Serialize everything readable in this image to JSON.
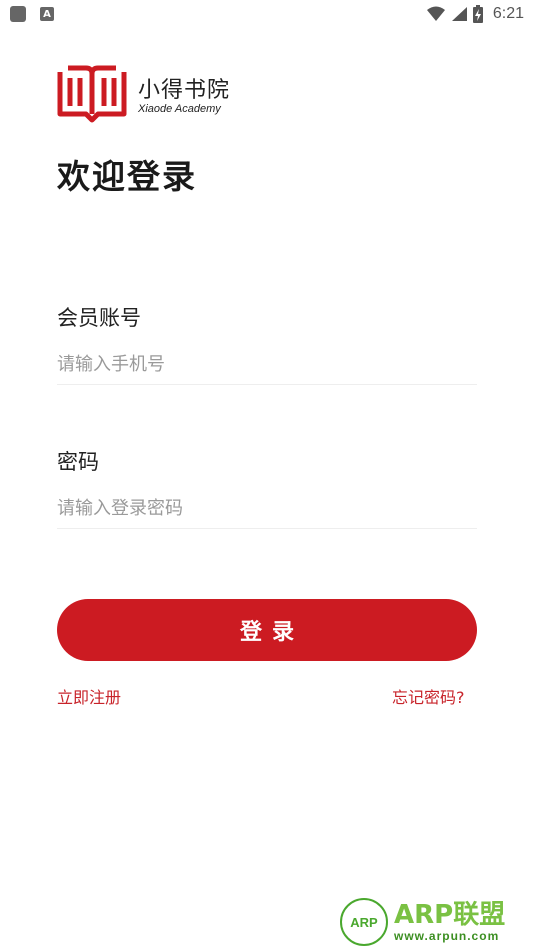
{
  "status_bar": {
    "time": "6:21",
    "left_icons": [
      "app-icon",
      "a-icon"
    ],
    "a_icon_letter": "A",
    "right_icons": [
      "wifi-icon",
      "signal-icon",
      "battery-icon"
    ]
  },
  "logo": {
    "name_cn": "小得书院",
    "name_en": "Xiaode Academy"
  },
  "page": {
    "title": "欢迎登录"
  },
  "form": {
    "account_label": "会员账号",
    "account_placeholder": "请输入手机号",
    "account_value": "",
    "password_label": "密码",
    "password_placeholder": "请输入登录密码",
    "password_value": "",
    "login_button": "登录"
  },
  "links": {
    "register": "立即注册",
    "forgot_password": "忘记密码?"
  },
  "watermark": {
    "badge": "ARP",
    "title": "ARP联盟",
    "url": "www.arpun.com"
  },
  "colors": {
    "brand_red": "#cc1b22",
    "link_red": "#c8232a",
    "watermark_green": "#7ac143"
  }
}
